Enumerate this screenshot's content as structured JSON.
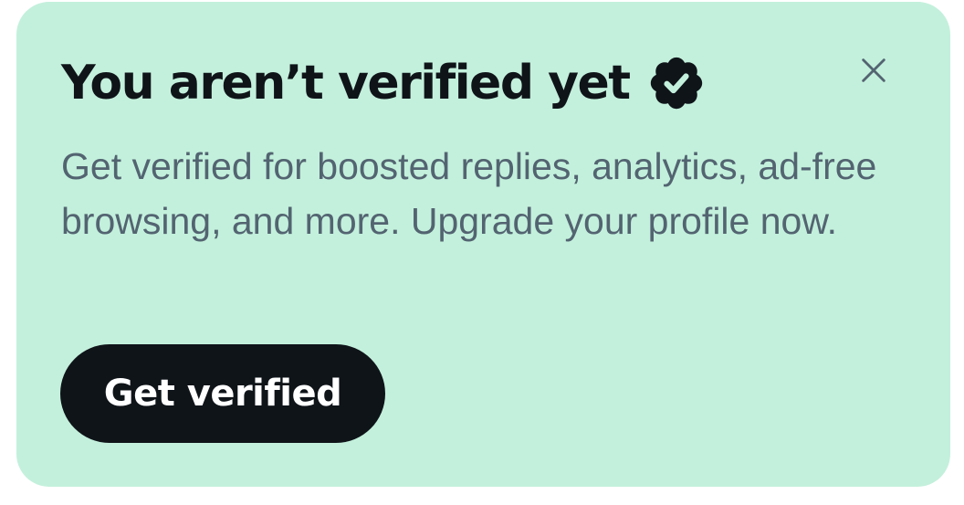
{
  "banner": {
    "title": "You aren’t verified yet",
    "badge_icon": "verified-badge-icon",
    "close_icon": "close-icon",
    "description": "Get verified for boosted replies, analytics, ad-free browsing, and more. Upgrade your profile now.",
    "cta_label": "Get verified"
  },
  "colors": {
    "background": "#c3f0dc",
    "title": "#0f1419",
    "description": "#536471",
    "button_bg": "#0f1419",
    "button_text": "#ffffff"
  }
}
